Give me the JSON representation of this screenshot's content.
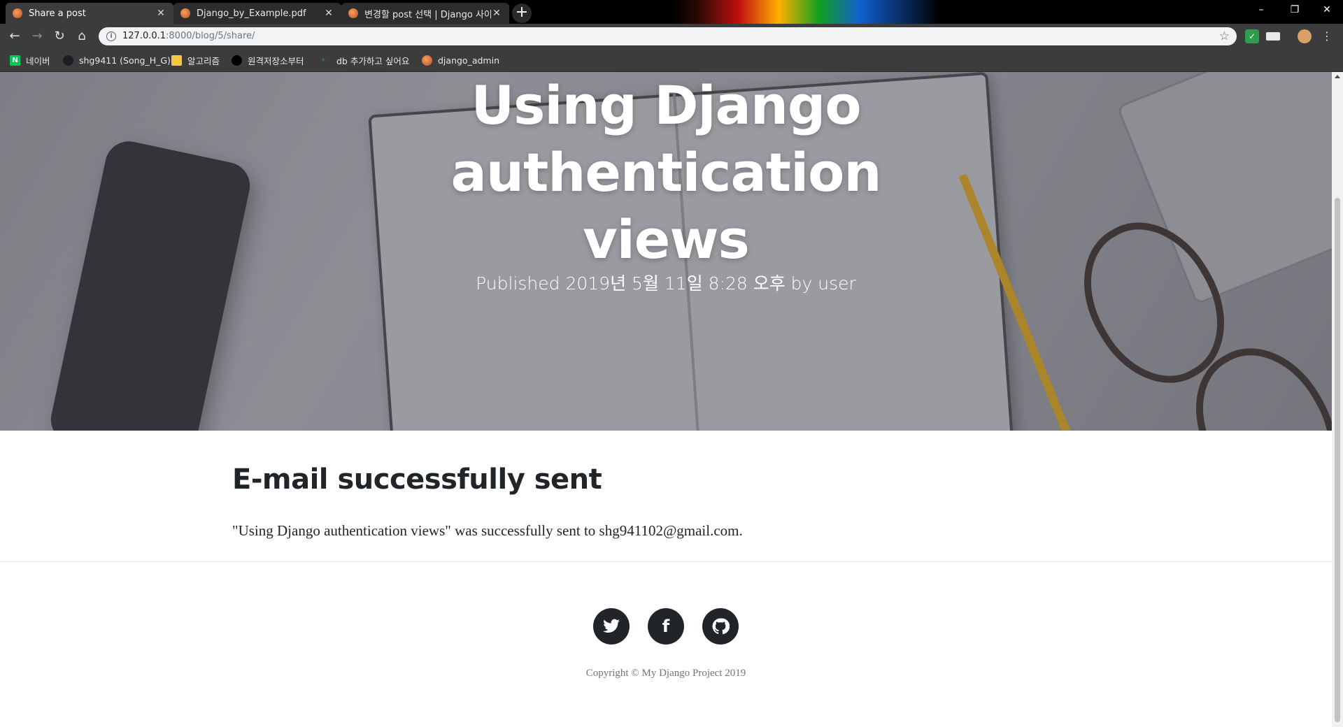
{
  "browser": {
    "tabs": [
      {
        "title": "Share a post",
        "active": true
      },
      {
        "title": "Django_by_Example.pdf",
        "active": false
      },
      {
        "title": "변경할 post 선택 | Django 사이",
        "active": false
      }
    ],
    "new_tab_label": "+",
    "window_controls": {
      "minimize": "–",
      "restore": "❐",
      "close": "✕"
    },
    "url_host": "127.0.0.1",
    "url_path": ":8000/blog/5/share/",
    "bookmarks": [
      {
        "label": "네이버",
        "icon": "naver-icon",
        "color": "#03c75a"
      },
      {
        "label": "shg9411 (Song_H_G)",
        "icon": "github-icon",
        "color": "#24292e"
      },
      {
        "label": "알고리즘",
        "icon": "folder-icon",
        "color": "#f6c744"
      },
      {
        "label": "원격저장소부터",
        "icon": "circle-icon",
        "color": "#000000"
      },
      {
        "label": "db 추가하고 싶어요",
        "icon": "leaf-icon",
        "color": "#2e7d32"
      },
      {
        "label": "django_admin",
        "icon": "site-icon",
        "color": "#d2691e"
      }
    ]
  },
  "page": {
    "hero_title": "Using Django authentication views",
    "hero_meta": "Published 2019년 5월 11일 8:28 오후 by user",
    "heading": "E-mail successfully sent",
    "message": "\"Using Django authentication views\" was successfully sent to shg941102@gmail.com.",
    "social": [
      {
        "name": "twitter",
        "icon": "twitter-icon"
      },
      {
        "name": "facebook",
        "icon": "facebook-icon",
        "glyph": "f"
      },
      {
        "name": "github",
        "icon": "github-icon"
      }
    ],
    "copyright": "Copyright © My Django Project 2019"
  }
}
